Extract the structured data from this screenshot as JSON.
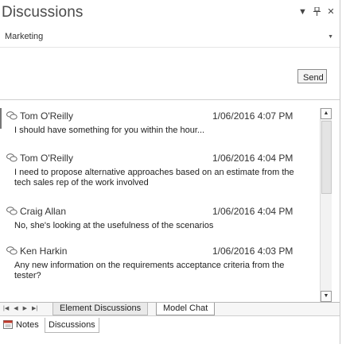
{
  "window": {
    "title": "Discussions",
    "dropdown_icon": "chevron-down-icon",
    "pin_icon": "pin-icon",
    "close_icon": "close-icon"
  },
  "channel": {
    "selected": "Marketing"
  },
  "compose": {
    "value": "",
    "send_label": "Send"
  },
  "messages": [
    {
      "author": "Tom O'Reilly",
      "time": "1/06/2016 4:07 PM",
      "text": "I should have something for you within the hour..."
    },
    {
      "author": "Tom O'Reilly",
      "time": "1/06/2016 4:04 PM",
      "text": "I need to propose alternative approaches based on an estimate from the tech sales rep of the work involved"
    },
    {
      "author": "Craig Allan",
      "time": "1/06/2016 4:04 PM",
      "text": "No, she's looking at the usefulness of the scenarios"
    },
    {
      "author": "Ken Harkin",
      "time": "1/06/2016 4:03 PM",
      "text": "Any new information on the requirements acceptance criteria from the tester?"
    }
  ],
  "tabs": [
    {
      "label": "Element Discussions"
    },
    {
      "label": "Model Chat"
    }
  ],
  "dock_tabs": [
    {
      "label": "Notes"
    },
    {
      "label": "Discussions"
    }
  ],
  "colors": {
    "title": "#4a4a4a",
    "border": "#b9b9b9"
  }
}
